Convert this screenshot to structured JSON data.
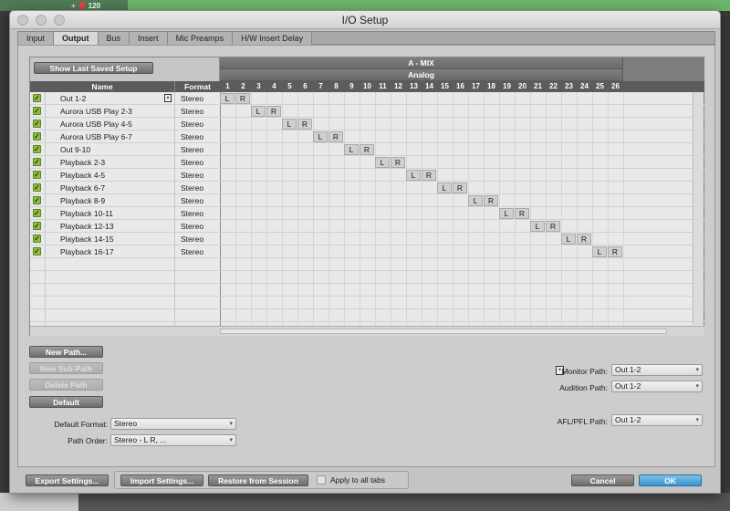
{
  "background": {
    "tempo": "120"
  },
  "window": {
    "title": "I/O Setup"
  },
  "tabs": [
    {
      "label": "Input",
      "active": false
    },
    {
      "label": "Output",
      "active": true
    },
    {
      "label": "Bus",
      "active": false
    },
    {
      "label": "Insert",
      "active": false
    },
    {
      "label": "Mic Preamps",
      "active": false
    },
    {
      "label": "H/W Insert Delay",
      "active": false
    }
  ],
  "grid": {
    "show_last_saved": "Show Last Saved Setup",
    "bus_name": "A - MIX",
    "bus_type": "Analog",
    "col_name": "Name",
    "col_format": "Format",
    "channels": [
      "1",
      "2",
      "3",
      "4",
      "5",
      "6",
      "7",
      "8",
      "9",
      "10",
      "11",
      "12",
      "13",
      "14",
      "15",
      "16",
      "17",
      "18",
      "19",
      "20",
      "21",
      "22",
      "23",
      "24",
      "25",
      "26"
    ],
    "rows": [
      {
        "name": "Out 1-2",
        "format": "Stereo",
        "checked": true
      },
      {
        "name": "Aurora USB Play 2-3",
        "format": "Stereo",
        "checked": true
      },
      {
        "name": "Aurora USB Play 4-5",
        "format": "Stereo",
        "checked": true
      },
      {
        "name": "Aurora USB Play 6-7",
        "format": "Stereo",
        "checked": true
      },
      {
        "name": "Out 9-10",
        "format": "Stereo",
        "checked": true
      },
      {
        "name": "Playback 2-3",
        "format": "Stereo",
        "checked": true
      },
      {
        "name": "Playback 4-5",
        "format": "Stereo",
        "checked": true
      },
      {
        "name": "Playback 6-7",
        "format": "Stereo",
        "checked": true
      },
      {
        "name": "Playback 8-9",
        "format": "Stereo",
        "checked": true
      },
      {
        "name": "Playback 10-11",
        "format": "Stereo",
        "checked": true
      },
      {
        "name": "Playback 12-13",
        "format": "Stereo",
        "checked": true
      },
      {
        "name": "Playback 14-15",
        "format": "Stereo",
        "checked": true
      },
      {
        "name": "Playback 16-17",
        "format": "Stereo",
        "checked": true
      }
    ],
    "left_label": "L",
    "right_label": "R"
  },
  "buttons": {
    "new_path": "New Path...",
    "new_sub_path": "New Sub-Path",
    "delete_path": "Delete Path",
    "default": "Default",
    "export": "Export Settings...",
    "import": "Import Settings...",
    "restore": "Restore from Session",
    "cancel": "Cancel",
    "ok": "OK"
  },
  "settings": {
    "default_format_label": "Default Format:",
    "default_format_value": "Stereo",
    "path_order_label": "Path Order:",
    "path_order_value": "Stereo - L R, ...",
    "monitor_path_label": "Monitor Path:",
    "monitor_path_value": "Out 1-2",
    "audition_path_label": "Audition Path:",
    "audition_path_value": "Out 1-2",
    "afl_pfl_label": "AFL/PFL Path:",
    "afl_pfl_value": "Out 1-2",
    "apply_all_tabs": "Apply to all tabs"
  },
  "colors": {
    "accent_ok": "#3b95cf",
    "check_green": "#8dbf42"
  }
}
